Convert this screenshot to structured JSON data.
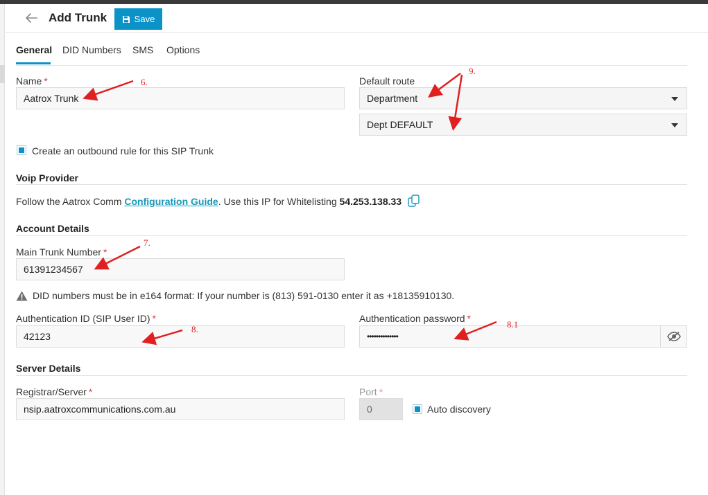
{
  "header": {
    "title": "Add Trunk",
    "save_label": "Save",
    "accent": "#0b93c7"
  },
  "tabs": [
    {
      "label": "General",
      "active": true
    },
    {
      "label": "DID Numbers",
      "active": false
    },
    {
      "label": "SMS",
      "active": false
    },
    {
      "label": "Options",
      "active": false
    }
  ],
  "general": {
    "name_label": "Name",
    "name_value": "Aatrox Trunk",
    "default_route_label": "Default route",
    "route_type_value": "Department",
    "route_target_value": "Dept DEFAULT",
    "outbound_rule_label": "Create an outbound rule for this SIP Trunk",
    "outbound_rule_checked": true
  },
  "voip": {
    "title": "Voip Provider",
    "prefix": "Follow the Aatrox Comm ",
    "guide_link": "Configuration Guide",
    "middle": ". Use this IP for Whitelisting ",
    "ip": "54.253.138.33"
  },
  "account": {
    "title": "Account Details",
    "main_number_label": "Main Trunk Number",
    "main_number_value": "61391234567",
    "did_hint": "DID numbers must be in e164 format: If your number is (813) 591-0130 enter it as +18135910130.",
    "auth_id_label": "Authentication ID (SIP User ID)",
    "auth_id_value": "42123",
    "auth_password_label": "Authentication password",
    "auth_password_value": "••••••••••••••"
  },
  "server": {
    "title": "Server Details",
    "registrar_label": "Registrar/Server",
    "registrar_value": "nsip.aatroxcommunications.com.au",
    "port_label": "Port",
    "port_value": "0",
    "auto_discovery_label": "Auto discovery",
    "auto_discovery_checked": true
  },
  "annotations": {
    "a6": "6.",
    "a7": "7.",
    "a8": "8.",
    "a81": "8.1",
    "a9": "9.",
    "color": "#e02020"
  }
}
